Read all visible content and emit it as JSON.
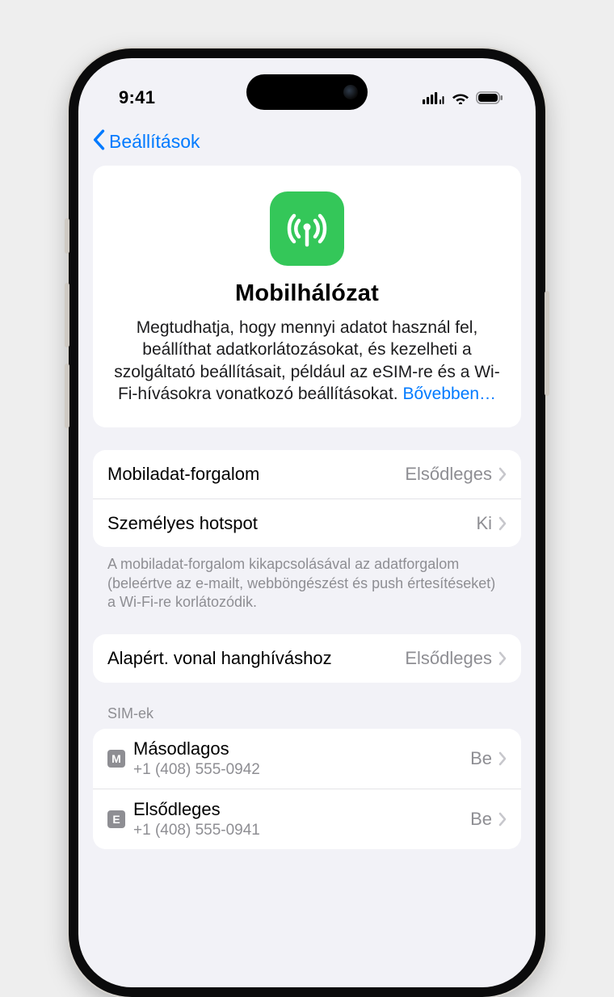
{
  "status": {
    "time": "9:41"
  },
  "nav": {
    "back_label": "Beállítások"
  },
  "hero": {
    "title": "Mobilhálózat",
    "description": "Megtudhatja, hogy mennyi adatot használ fel, beállíthat adatkorlátozásokat, és kezelheti a szolgáltató beállításait, például az eSIM-re és a Wi-Fi-hívásokra vonatkozó beállításokat.",
    "more": "Bővebben…"
  },
  "rows": {
    "cellular_data": {
      "label": "Mobiladat-forgalom",
      "value": "Elsődleges"
    },
    "hotspot": {
      "label": "Személyes hotspot",
      "value": "Ki"
    },
    "default_line": {
      "label": "Alapért. vonal hanghíváshoz",
      "value": "Elsődleges"
    }
  },
  "notes": {
    "data_off": "A mobiladat-forgalom kikapcsolásával az adatforgalom (beleértve az e-mailt, webböngészést és push értesítéseket) a Wi-Fi-re korlátozódik."
  },
  "sims": {
    "header": "SIM-ek",
    "items": [
      {
        "badge": "M",
        "name": "Másodlagos",
        "number": "+1 (408) 555-0942",
        "status": "Be"
      },
      {
        "badge": "E",
        "name": "Elsődleges",
        "number": "+1 (408) 555-0941",
        "status": "Be"
      }
    ]
  }
}
